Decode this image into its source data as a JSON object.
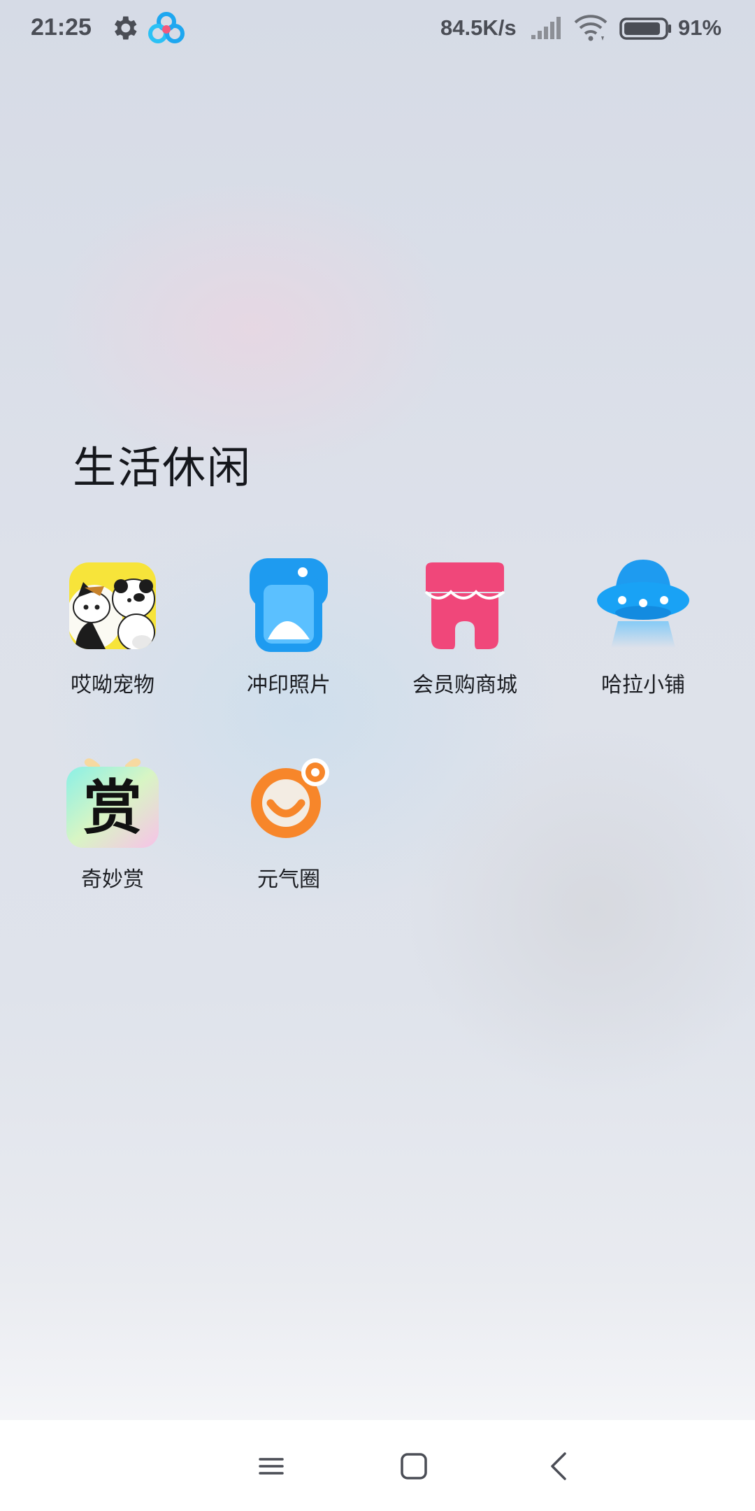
{
  "status_bar": {
    "time": "21:25",
    "net_speed": "84.5K/s",
    "battery_percent": "91%",
    "battery_level": 0.91,
    "icons": [
      "gear-icon",
      "cloud-app-icon",
      "cellular-signal-icon",
      "wifi-icon",
      "battery-icon"
    ]
  },
  "folder": {
    "title": "生活休闲",
    "apps": [
      {
        "label": "哎呦宠物",
        "icon": "pet-app-icon"
      },
      {
        "label": "冲印照片",
        "icon": "photo-print-app-icon"
      },
      {
        "label": "会员购商城",
        "icon": "member-shop-app-icon"
      },
      {
        "label": "哈拉小铺",
        "icon": "hala-shop-app-icon"
      },
      {
        "label": "奇妙赏",
        "icon": "qimiaoshang-app-icon",
        "glyph": "赏"
      },
      {
        "label": "元气圈",
        "icon": "yuanqiquan-app-icon"
      }
    ]
  },
  "nav_bar": {
    "icons": [
      "menu-icon",
      "home-icon",
      "back-icon"
    ]
  },
  "colors": {
    "text_dark": "#15171c",
    "status_text": "#4a4d55",
    "blue": "#1e9bf0",
    "pink": "#f0477a",
    "orange": "#f7862a",
    "yellow": "#f7e43a"
  }
}
